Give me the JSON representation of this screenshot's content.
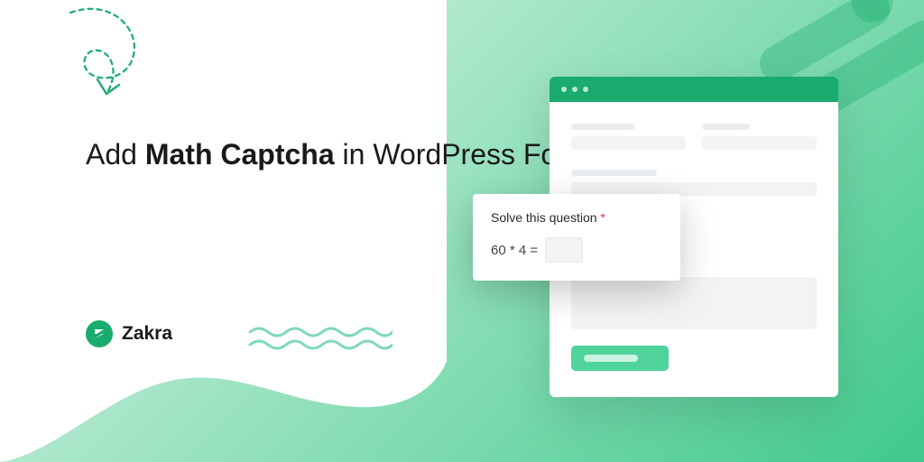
{
  "headline": {
    "pre": "Add ",
    "bold": "Math Captcha",
    "post": " in WordPress Forms"
  },
  "logo": {
    "text": "Zakra"
  },
  "captcha": {
    "label": "Solve this question",
    "required_mark": "*",
    "expression": "60 * 4 ="
  },
  "colors": {
    "accent": "#1aab6e",
    "gradient_light": "#e8f8ef",
    "required": "#e03131"
  }
}
